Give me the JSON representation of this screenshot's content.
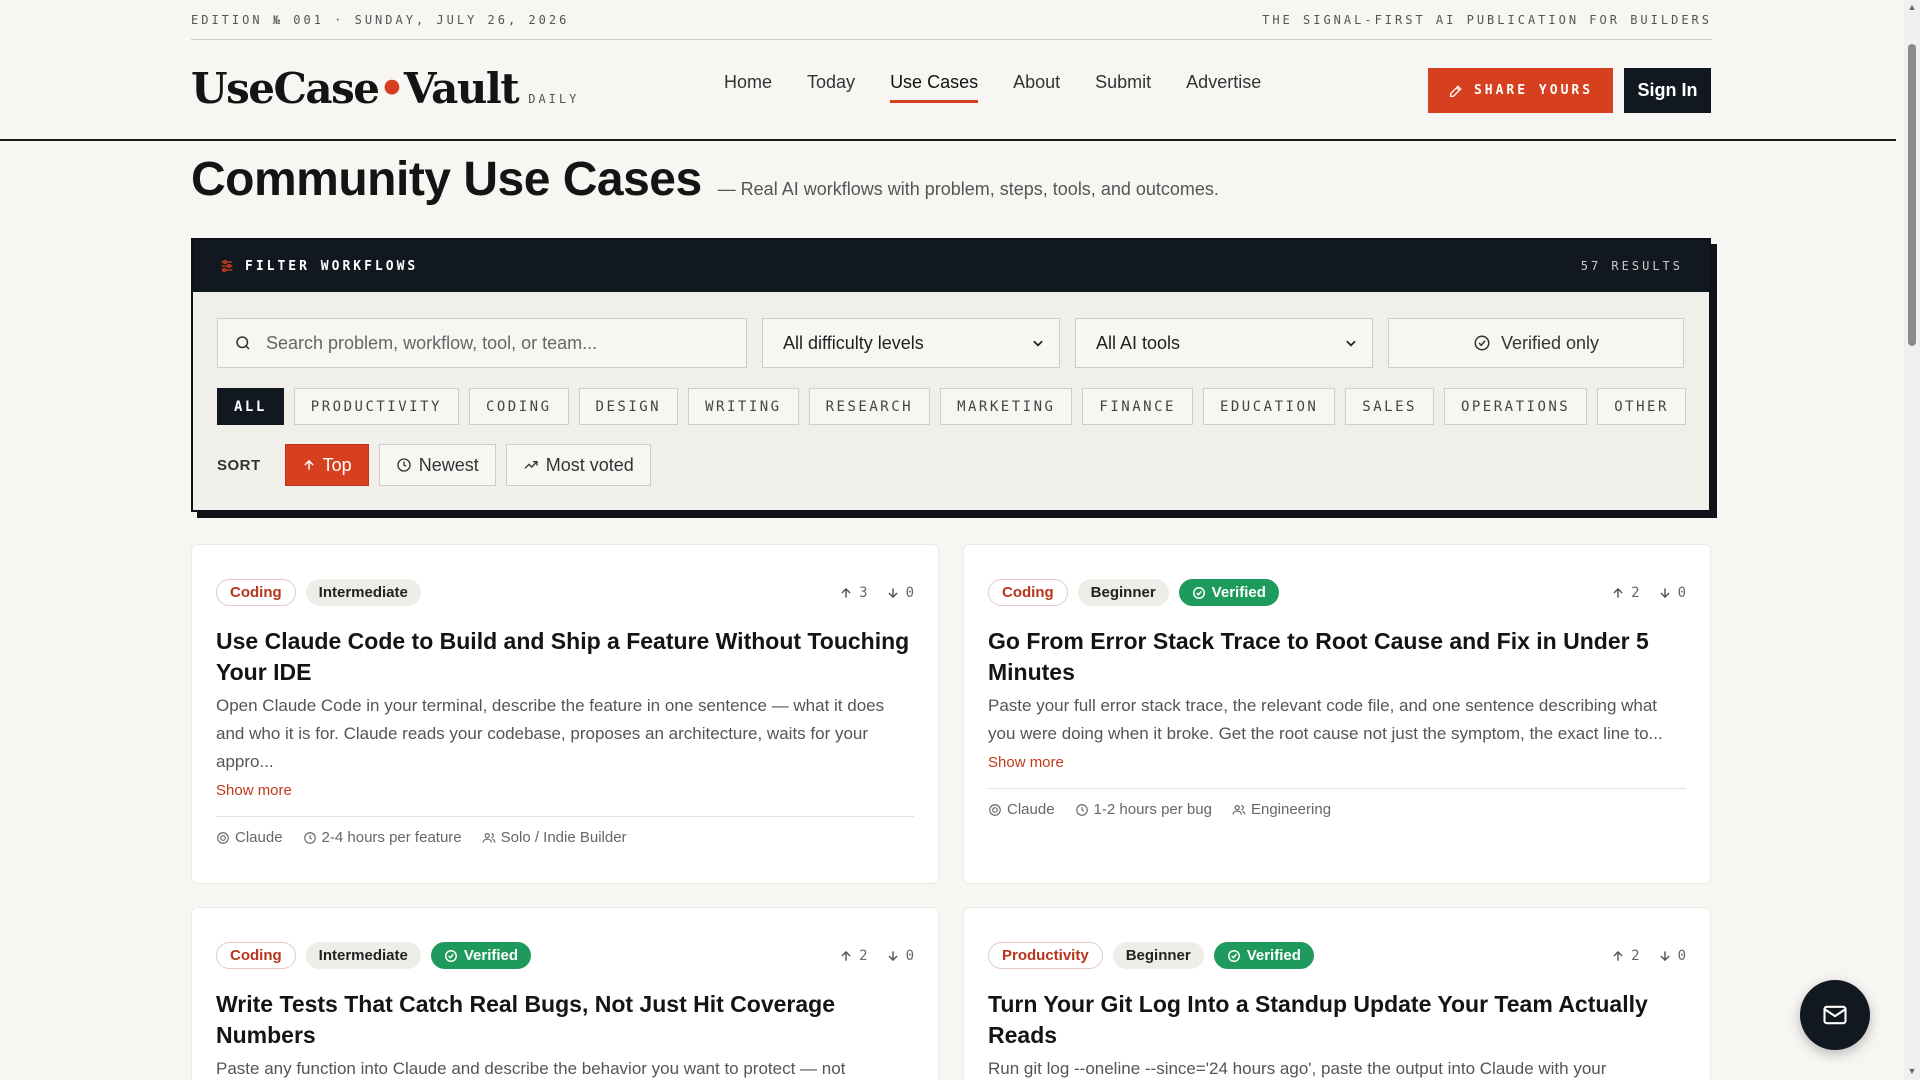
{
  "topstrip": {
    "left": "EDITION № 001 · SUNDAY, JULY 26, 2026",
    "right": "THE SIGNAL-FIRST AI PUBLICATION FOR BUILDERS"
  },
  "brand": {
    "name_a": "UseCase",
    "dot": "•",
    "name_b": "Vault",
    "sub": "DAILY"
  },
  "nav": {
    "items": [
      "Home",
      "Today",
      "Use Cases",
      "About",
      "Submit",
      "Advertise"
    ],
    "active": "Use Cases"
  },
  "header_actions": {
    "share": "SHARE YOURS",
    "signin": "Sign In"
  },
  "page": {
    "title": "Community Use Cases",
    "subtitle": "— Real AI workflows with problem, steps, tools, and outcomes."
  },
  "filter": {
    "heading": "FILTER WORKFLOWS",
    "results": "57 RESULTS",
    "search_placeholder": "Search problem, workflow, tool, or team...",
    "difficulty": "All difficulty levels",
    "tools": "All AI tools",
    "verified": "Verified only",
    "categories": [
      "ALL",
      "PRODUCTIVITY",
      "CODING",
      "DESIGN",
      "WRITING",
      "RESEARCH",
      "MARKETING",
      "FINANCE",
      "EDUCATION",
      "SALES",
      "OPERATIONS",
      "OTHER"
    ],
    "active_category": "ALL",
    "sort_label": "SORT",
    "sort_options": [
      "Top",
      "Newest",
      "Most voted"
    ],
    "active_sort": "Top"
  },
  "cards": [
    {
      "category": "Coding",
      "level": "Intermediate",
      "verified": "",
      "up": "3",
      "down": "0",
      "title": "Use Claude Code to Build and Ship a Feature Without Touching Your IDE",
      "desc": "Open Claude Code in your terminal, describe the feature in one sentence — what it does and who it is for. Claude reads your codebase, proposes an architecture, waits for your appro...",
      "show_more": "Show more",
      "tool": "Claude",
      "time": "2-4 hours per feature",
      "team": "Solo / Indie Builder"
    },
    {
      "category": "Coding",
      "level": "Beginner",
      "verified": "Verified",
      "up": "2",
      "down": "0",
      "title": "Go From Error Stack Trace to Root Cause and Fix in Under 5 Minutes",
      "desc": "Paste your full error stack trace, the relevant code file, and one sentence describing what you were doing when it broke. Get the root cause not just the symptom, the exact line to...",
      "show_more": "Show more",
      "tool": "Claude",
      "time": "1-2 hours per bug",
      "team": "Engineering"
    },
    {
      "category": "Coding",
      "level": "Intermediate",
      "verified": "Verified",
      "up": "2",
      "down": "0",
      "title": "Write Tests That Catch Real Bugs, Not Just Hit Coverage Numbers",
      "desc": "Paste any function into Claude and describe the behavior you want to protect — not"
    },
    {
      "category": "Productivity",
      "level": "Beginner",
      "verified": "Verified",
      "up": "2",
      "down": "0",
      "title": "Turn Your Git Log Into a Standup Update Your Team Actually Reads",
      "desc": "Run git log --oneline --since='24 hours ago', paste the output into Claude with your"
    }
  ],
  "colors": {
    "accent": "#d7401e",
    "dark": "#121820",
    "verified": "#1e9a5c",
    "bg": "#f7f6f3"
  }
}
